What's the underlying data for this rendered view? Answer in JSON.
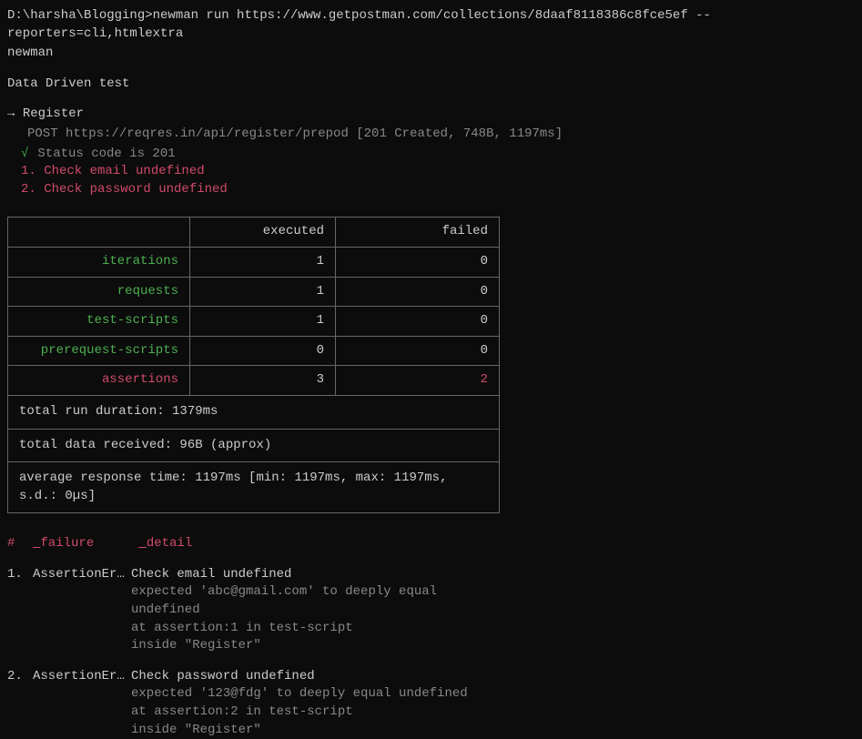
{
  "prompt": "D:\\harsha\\Blogging>newman run https://www.getpostman.com/collections/8daaf8118386c8fce5ef --reporters=cli,htmlextra",
  "tool_name": "newman",
  "collection_name": "Data Driven test",
  "request": {
    "arrow": "→",
    "name": "Register",
    "line": "POST https://reqres.in/api/register/prepod [201 Created, 748B, 1197ms]"
  },
  "assertions": [
    {
      "type": "pass",
      "mark": "√",
      "text": "Status code is 201"
    },
    {
      "type": "fail",
      "text": "1. Check email undefined"
    },
    {
      "type": "fail",
      "text": "2. Check password undefined"
    }
  ],
  "summary": {
    "headers": {
      "blank": "",
      "executed": "executed",
      "failed": "failed"
    },
    "rows": [
      {
        "name": "iterations",
        "executed": "1",
        "failed": "0",
        "nameClass": "green"
      },
      {
        "name": "requests",
        "executed": "1",
        "failed": "0",
        "nameClass": "green"
      },
      {
        "name": "test-scripts",
        "executed": "1",
        "failed": "0",
        "nameClass": "green"
      },
      {
        "name": "prerequest-scripts",
        "executed": "0",
        "failed": "0",
        "nameClass": "green"
      },
      {
        "name": "assertions",
        "executed": "3",
        "failed": "2",
        "nameClass": "red",
        "failedClass": "red"
      }
    ],
    "footer": [
      "total run duration: 1379ms",
      "total data received: 96B (approx)",
      "average response time: 1197ms [min: 1197ms, max: 1197ms, s.d.: 0µs]"
    ]
  },
  "failures": {
    "header": {
      "hash": "#",
      "failure": "failure",
      "detail": "detail"
    },
    "items": [
      {
        "num": "1.",
        "err": "AssertionEr…",
        "title": "Check email undefined",
        "lines": [
          "expected 'abc@gmail.com' to deeply equal",
          "undefined",
          "at assertion:1 in test-script",
          "inside \"Register\""
        ]
      },
      {
        "num": "2.",
        "err": "AssertionEr…",
        "title": "Check password undefined",
        "lines": [
          "expected '123@fdg' to deeply equal undefined",
          "at assertion:2 in test-script",
          "inside \"Register\""
        ]
      }
    ]
  }
}
